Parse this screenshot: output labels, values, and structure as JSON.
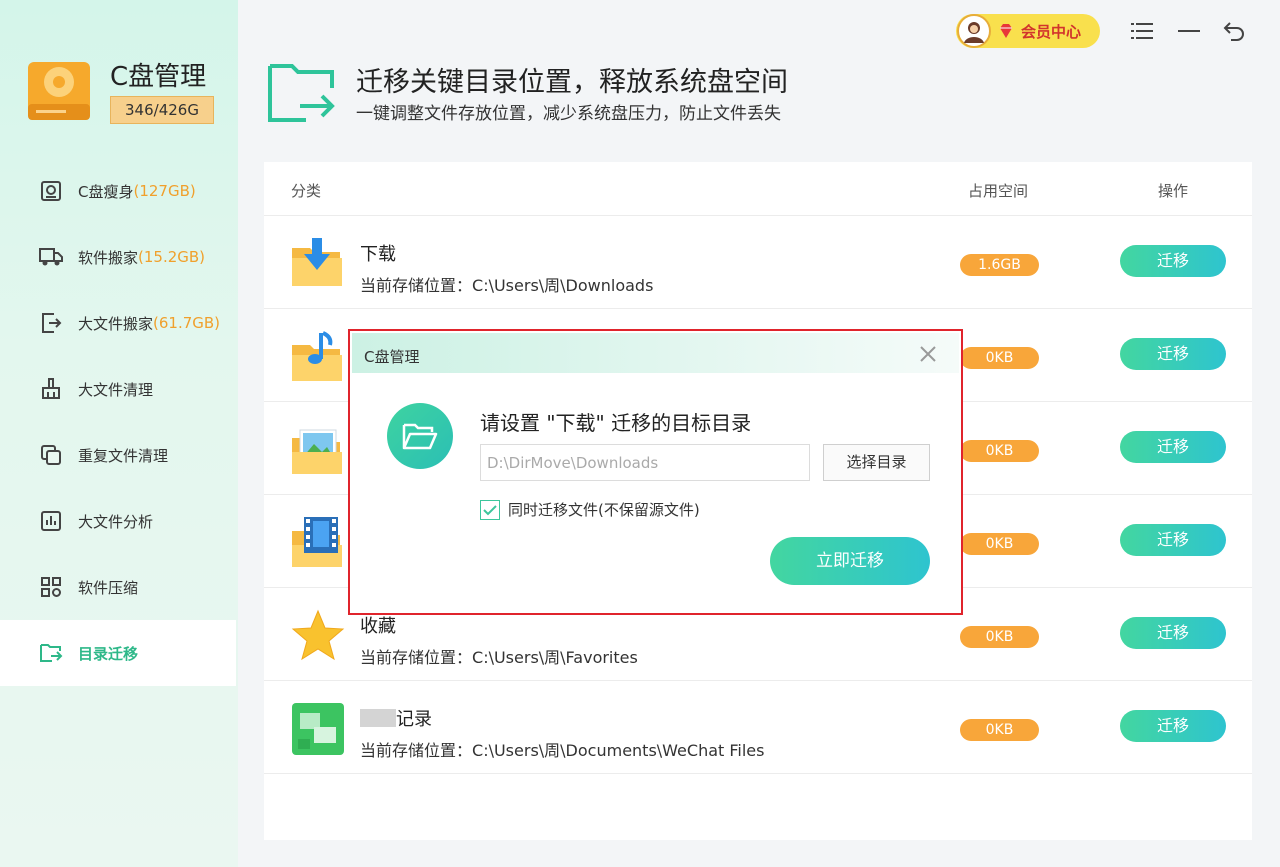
{
  "app": {
    "title": "C盘管理",
    "disk_usage": "346/426G"
  },
  "sidebar": {
    "items": [
      {
        "label": "C盘瘦身",
        "extra": "(127GB)",
        "icon": "disk-slim-icon",
        "active": false
      },
      {
        "label": "软件搬家",
        "extra": "(15.2GB)",
        "icon": "truck-icon",
        "active": false
      },
      {
        "label": "大文件搬家",
        "extra": "(61.7GB)",
        "icon": "file-export-icon",
        "active": false
      },
      {
        "label": "大文件清理",
        "extra": "",
        "icon": "broom-icon",
        "active": false
      },
      {
        "label": "重复文件清理",
        "extra": "",
        "icon": "duplicate-icon",
        "active": false
      },
      {
        "label": "大文件分析",
        "extra": "",
        "icon": "bar-chart-icon",
        "active": false
      },
      {
        "label": "软件压缩",
        "extra": "",
        "icon": "compress-icon",
        "active": false
      },
      {
        "label": "目录迁移",
        "extra": "",
        "icon": "folder-move-icon",
        "active": true
      }
    ]
  },
  "toolbar": {
    "vip_label": "会员中心"
  },
  "header": {
    "title": "迁移关键目录位置，释放系统盘空间",
    "subtitle": "一键调整文件存放位置，减少系统盘压力，防止文件丢失"
  },
  "table": {
    "columns": {
      "category": "分类",
      "size": "占用空间",
      "action": "操作"
    },
    "path_prefix": "当前存储位置：",
    "rows": [
      {
        "name": "下载",
        "path": "C:\\Users\\周\\Downloads",
        "size": "1.6GB",
        "action": "迁移",
        "icon": "download-folder-icon"
      },
      {
        "name": "",
        "path": "",
        "size": "0KB",
        "action": "迁移",
        "icon": "music-folder-icon"
      },
      {
        "name": "",
        "path": "",
        "size": "0KB",
        "action": "迁移",
        "icon": "picture-folder-icon"
      },
      {
        "name": "",
        "path": "",
        "size": "0KB",
        "action": "迁移",
        "icon": "video-folder-icon"
      },
      {
        "name": "收藏",
        "path": "C:\\Users\\周\\Favorites",
        "size": "0KB",
        "action": "迁移",
        "icon": "star-icon"
      },
      {
        "name": "记录",
        "path": "C:\\Users\\周\\Documents\\WeChat Files",
        "size": "0KB",
        "action": "迁移",
        "icon": "wechat-icon"
      }
    ]
  },
  "dialog": {
    "title": "C盘管理",
    "question": "请设置 \"下载\" 迁移的目标目录",
    "path_value": "D:\\DirMove\\Downloads",
    "browse_label": "选择目录",
    "checkbox_label": "同时迁移文件(不保留源文件)",
    "checkbox_checked": true,
    "submit_label": "立即迁移"
  }
}
